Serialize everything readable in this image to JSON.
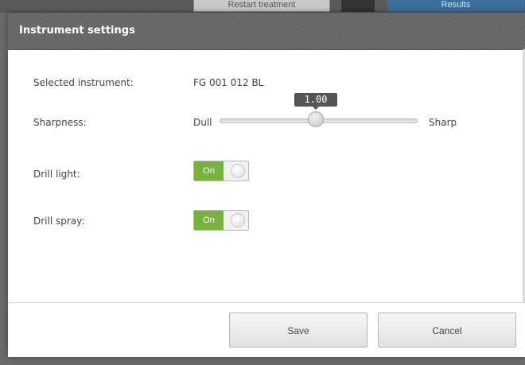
{
  "background": {
    "restart_label": "Restart treatment",
    "results_label": "Results"
  },
  "dialog": {
    "title": "Instrument settings",
    "selected_instrument_label": "Selected instrument:",
    "selected_instrument_value": "FG 001 012 BL",
    "sharpness_label": "Sharpness:",
    "sharpness": {
      "min_label": "Dull",
      "max_label": "Sharp",
      "value": "1.00"
    },
    "drill_light_label": "Drill light:",
    "drill_light_state": "On",
    "drill_spray_label": "Drill spray:",
    "drill_spray_state": "On"
  },
  "footer": {
    "save_label": "Save",
    "cancel_label": "Cancel"
  },
  "colors": {
    "title_bar": "#6c6c6c",
    "toggle_on": "#78b23c",
    "tooltip": "#555555"
  }
}
